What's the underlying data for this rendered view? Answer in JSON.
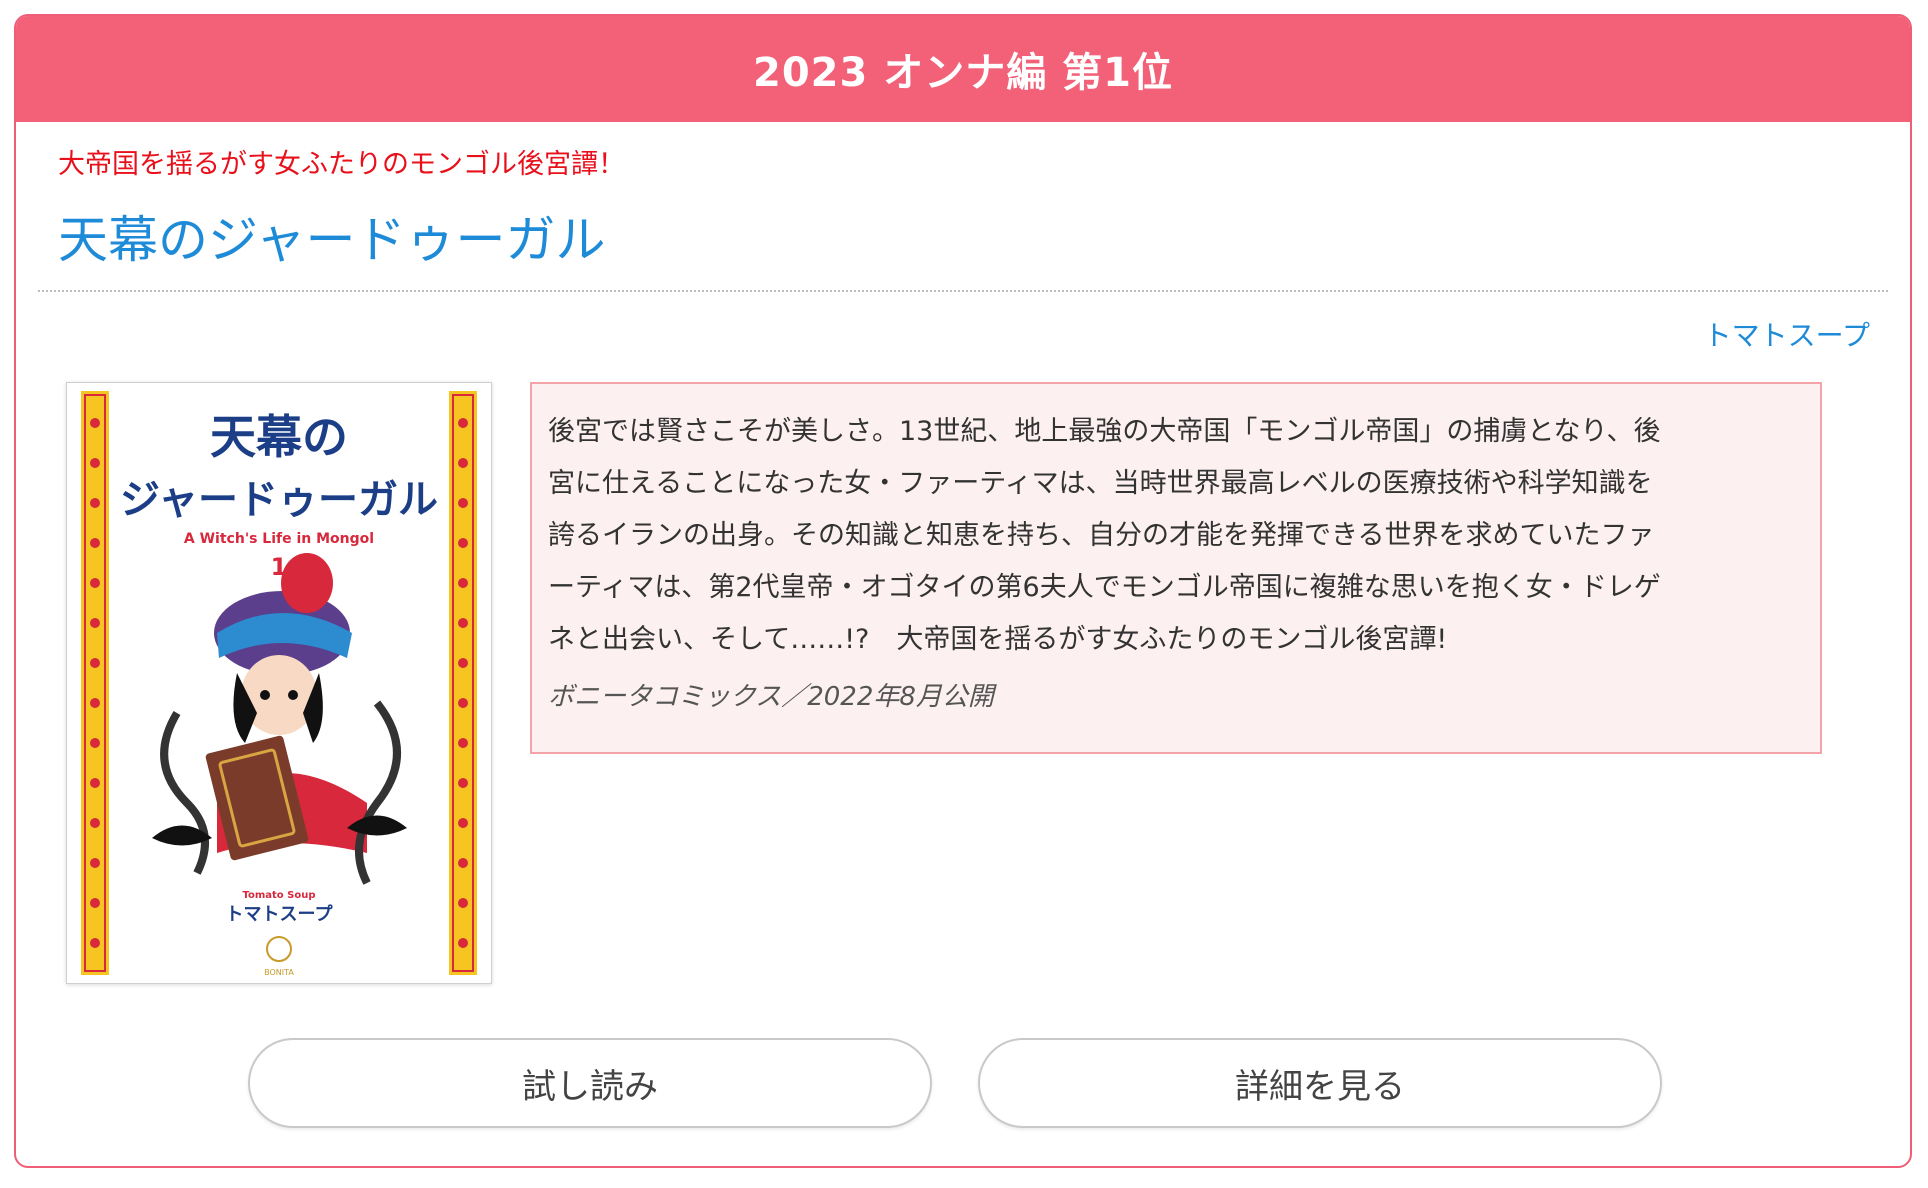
{
  "banner": {
    "title": "2023 オンナ編 第1位"
  },
  "work": {
    "catchphrase": "大帝国を揺るがす女ふたりのモンゴル後宮譚！",
    "title": "天幕のジャードゥーガル",
    "author": "トマトスープ",
    "synopsis_lines": [
      "後宮では賢さこそが美しさ。13世紀、地上最強の大帝国「モンゴル帝国」の捕虜となり、後",
      "宮に仕えることになった女・ファーティマは、当時世界最高レベルの医療技術や科学知識を",
      "誇るイランの出身。その知識と知恵を持ち、自分の才能を発揮できる世界を求めていたファ",
      "ーティマは、第2代皇帝・オゴタイの第6夫人でモンゴル帝国に複雑な思いを抱く女・ドレゲ",
      "ネと出会い、そして……!?　大帝国を揺るがす女ふたりのモンゴル後宮譚!"
    ],
    "publisher_info": "ボニータコミックス／2022年8月公開"
  },
  "cover": {
    "title_line1": "天幕の",
    "title_line2": "ジャードゥーガル",
    "subtitle_en": "A Witch's Life in Mongol",
    "volume": "1",
    "author_en": "Tomato Soup",
    "author_jp": "トマトスープ",
    "imprint": "BONITA"
  },
  "buttons": {
    "trial": "試し読み",
    "detail": "詳細を見る"
  },
  "colors": {
    "banner": "#f26178",
    "border": "#ef5e76",
    "catch": "#e8111b",
    "link": "#1e8bd8",
    "synopsis_bg": "#fdf0f0",
    "synopsis_border": "#f4a3a8"
  }
}
